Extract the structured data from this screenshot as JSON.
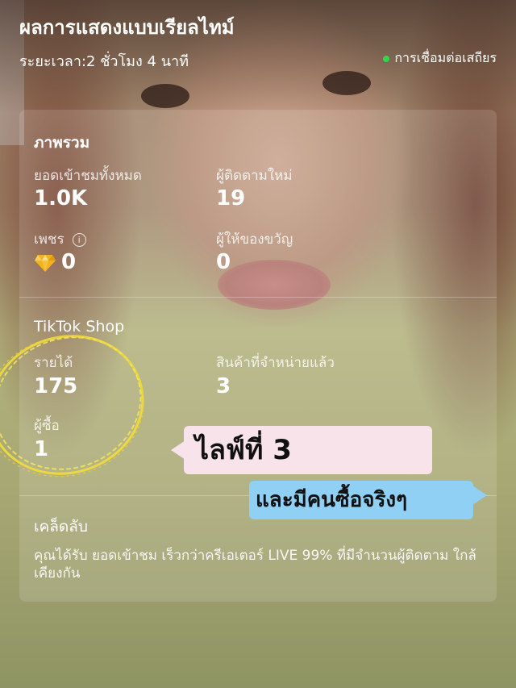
{
  "header": {
    "title": "ผลการแสดงแบบเรียลไทม์",
    "duration": "ระยะเวลา:2 ชั่วโมง 4 นาที",
    "connection_status": "การเชื่อมต่อเสถียร",
    "status_color": "#33d44e"
  },
  "overview": {
    "section_title": "ภาพรวม",
    "total_views_label": "ยอดเข้าชมทั้งหมด",
    "total_views_value": "1.0K",
    "new_followers_label": "ผู้ติดตามใหม่",
    "new_followers_value": "19",
    "diamonds_label": "เพชร",
    "diamonds_value": "0",
    "gifters_label": "ผู้ให้ของขวัญ",
    "gifters_value": "0"
  },
  "shop": {
    "section_title": "TikTok Shop",
    "revenue_label": "รายได้",
    "revenue_value": "175",
    "products_sold_label": "สินค้าที่จำหน่ายแล้ว",
    "products_sold_value": "3",
    "buyers_label": "ผู้ซื้อ",
    "buyers_value": "1"
  },
  "tip": {
    "section_title": "เคล็ดลับ",
    "text": "คุณได้รับ ยอดเข้าชม เร็วกว่าครีเอเตอร์ LIVE 99% ที่มีจำนวนผู้ติดตาม ใกล้เคียงกัน"
  },
  "stickers": {
    "live_number": "ไลฟ์ที่ 3",
    "real_buyer": "และมีคนซื้อจริงๆ"
  },
  "icons": {
    "diamond": "diamond-icon",
    "info": "info-icon"
  }
}
